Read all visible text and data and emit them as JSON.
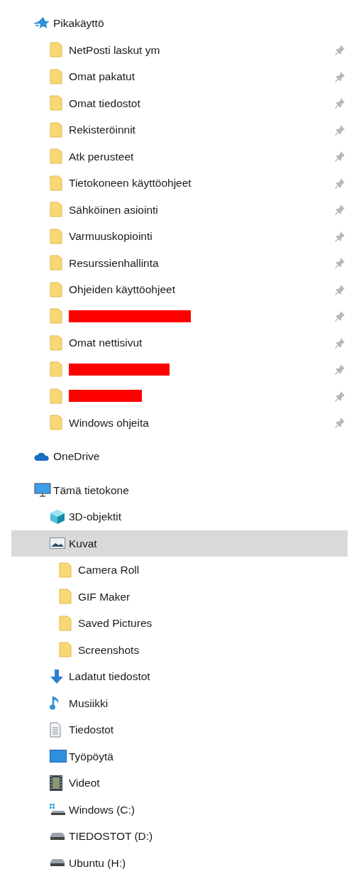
{
  "tree": [
    {
      "label": "Pikakäyttö",
      "kind": "star",
      "selected": false,
      "children": [
        {
          "label": "NetPosti laskut ym",
          "kind": "folder",
          "pinned": true,
          "selected": false
        },
        {
          "label": "Omat pakatut",
          "kind": "folder",
          "pinned": true,
          "selected": false
        },
        {
          "label": "Omat tiedostot",
          "kind": "folder",
          "pinned": true,
          "selected": false
        },
        {
          "label": "Rekisteröinnit",
          "kind": "folder",
          "pinned": true,
          "selected": false
        },
        {
          "label": "Atk perusteet",
          "kind": "folder",
          "pinned": true,
          "selected": false
        },
        {
          "label": "Tietokoneen käyttöohjeet",
          "kind": "folder",
          "pinned": true,
          "selected": false
        },
        {
          "label": "Sähköinen asiointi",
          "kind": "folder",
          "pinned": true,
          "selected": false
        },
        {
          "label": "Varmuuskopiointi",
          "kind": "folder",
          "pinned": true,
          "selected": false
        },
        {
          "label": "Resurssienhallinta",
          "kind": "folder",
          "pinned": true,
          "selected": false
        },
        {
          "label": "Ohjeiden käyttöohjeet",
          "kind": "folder",
          "pinned": true,
          "selected": false
        },
        {
          "redacted": true,
          "kind": "folder",
          "pinned": true,
          "selected": false
        },
        {
          "label": "Omat nettisivut",
          "kind": "folder",
          "pinned": true,
          "selected": false
        },
        {
          "redacted": true,
          "kind": "folder",
          "pinned": true,
          "selected": false
        },
        {
          "redacted": true,
          "kind": "folder",
          "pinned": true,
          "selected": false
        },
        {
          "label": "Windows ohjeita",
          "kind": "folder",
          "pinned": true,
          "selected": false
        }
      ]
    },
    {
      "label": "OneDrive",
      "kind": "cloud",
      "selected": false
    },
    {
      "label": "Tämä tietokone",
      "kind": "pc",
      "selected": false,
      "children": [
        {
          "label": "3D-objektit",
          "kind": "cube",
          "selected": false
        },
        {
          "label": "Kuvat",
          "kind": "pictures",
          "selected": true,
          "children": [
            {
              "label": "Camera Roll",
              "kind": "folder",
              "selected": false
            },
            {
              "label": "GIF Maker",
              "kind": "folder",
              "selected": false
            },
            {
              "label": "Saved Pictures",
              "kind": "folder",
              "selected": false
            },
            {
              "label": "Screenshots",
              "kind": "folder",
              "selected": false
            }
          ]
        },
        {
          "label": "Ladatut tiedostot",
          "kind": "download",
          "selected": false
        },
        {
          "label": "Musiikki",
          "kind": "music",
          "selected": false
        },
        {
          "label": "Tiedostot",
          "kind": "document",
          "selected": false
        },
        {
          "label": "Työpöytä",
          "kind": "desktop",
          "selected": false
        },
        {
          "label": "Videot",
          "kind": "film",
          "selected": false
        },
        {
          "label": "Windows (C:)",
          "kind": "windows-drive",
          "selected": false
        },
        {
          "label": "TIEDOSTOT (D:)",
          "kind": "drive",
          "selected": false
        },
        {
          "label": "Ubuntu (H:)",
          "kind": "drive",
          "selected": false
        }
      ]
    }
  ]
}
